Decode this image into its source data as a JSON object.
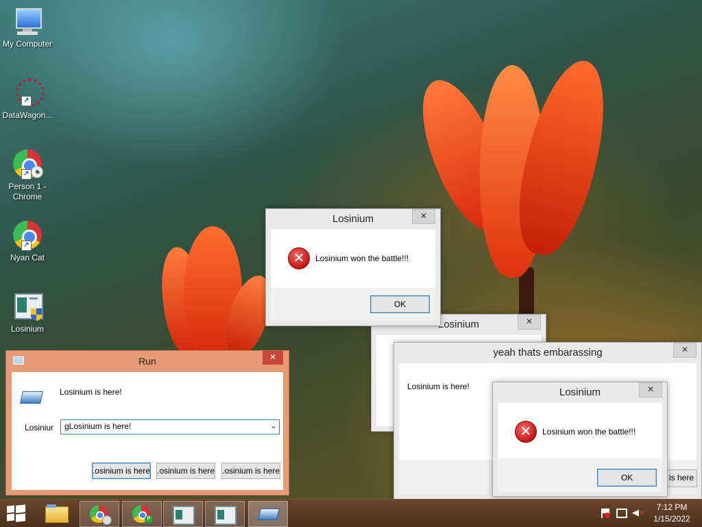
{
  "desktop": {
    "icons": [
      {
        "label": "My Computer",
        "icon": "computer-icon"
      },
      {
        "label": "DataWagon...",
        "icon": "datawagon-icon"
      },
      {
        "label": "Person 1 - Chrome",
        "icon": "chrome-icon"
      },
      {
        "label": "Nyan Cat",
        "icon": "chrome-icon"
      },
      {
        "label": "Losinium",
        "icon": "app-window-shield-icon"
      }
    ]
  },
  "dialogs": {
    "top": {
      "title": "Losinium",
      "message": "Losinium won the battle!!!",
      "ok": "OK",
      "close": "✕"
    },
    "middle": {
      "title": "Losinium",
      "close": "✕"
    },
    "embarrassing": {
      "title": "yeah thats embarassing",
      "message": "Losinium is here!",
      "button_partial": "n is here",
      "close": "✕"
    },
    "inner": {
      "title": "Losinium",
      "message": "Losinium won the battle!!!",
      "ok": "OK",
      "close": "✕"
    }
  },
  "run": {
    "title": "Run",
    "close": "✕",
    "description": "Losinium is here!",
    "open_label": "Losiniur",
    "input_value": "gLosinium is here!",
    "buttons": [
      ".osinium is here",
      ".osinium is here",
      ".osinium is here"
    ]
  },
  "taskbar": {
    "start_icon": "windows-logo-icon",
    "items": [
      {
        "icon": "file-explorer-icon"
      },
      {
        "icon": "chrome-person-icon"
      },
      {
        "icon": "chrome-p-icon"
      },
      {
        "icon": "app-window-icon"
      },
      {
        "icon": "app-window-icon"
      },
      {
        "icon": "run-icon"
      }
    ],
    "clock": {
      "time": "7:12 PM",
      "date": "1/15/2022"
    }
  },
  "colors": {
    "run_frame": "#e79a76",
    "taskbar": "#5b3a24",
    "error_red": "#c41616"
  }
}
